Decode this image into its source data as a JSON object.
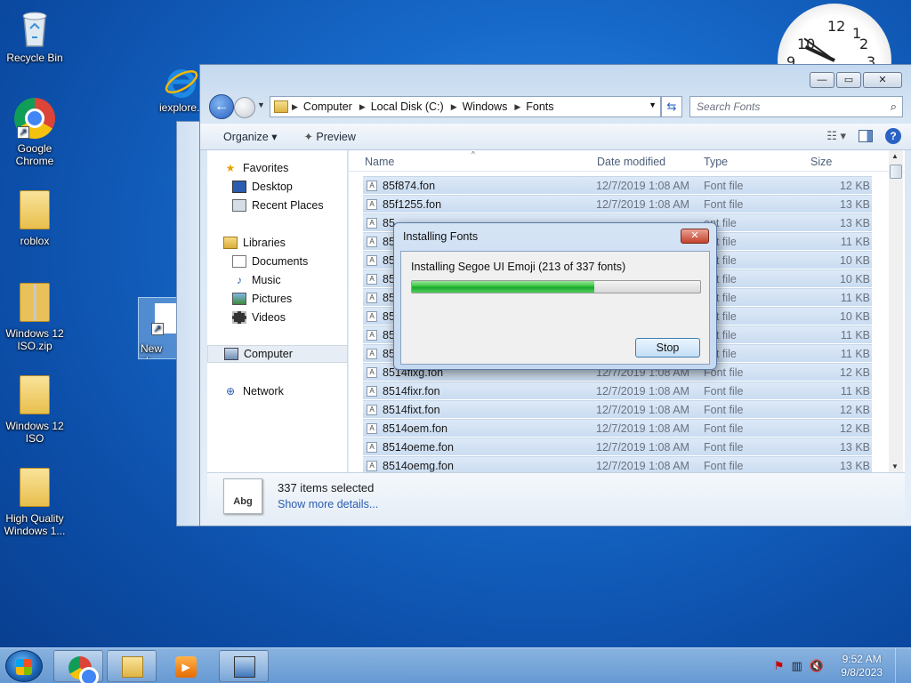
{
  "desktop": {
    "icons": [
      {
        "label": "Recycle Bin",
        "icon": "recycle-bin-icon"
      },
      {
        "label": "Google\nChrome",
        "icon": "chrome-icon"
      },
      {
        "label": "roblox",
        "icon": "folder-icon"
      },
      {
        "label": "Windows 12\nISO.zip",
        "icon": "zip-folder-icon"
      },
      {
        "label": "Windows 12\nISO",
        "icon": "folder-icon"
      },
      {
        "label": "High Quality\nWindows 1...",
        "icon": "folder-icon"
      },
      {
        "label": "iexplore...",
        "icon": "internet-explorer-icon"
      },
      {
        "label": "New sh...",
        "icon": "shortcut-icon"
      }
    ]
  },
  "clock": {
    "numbers": [
      "12",
      "1",
      "2",
      "3",
      "10",
      "9"
    ]
  },
  "explorer": {
    "controls": {
      "minimize": "—",
      "maximize": "▭",
      "close": "✕"
    },
    "breadcrumbs": [
      "Computer",
      "Local Disk (C:)",
      "Windows",
      "Fonts"
    ],
    "search_placeholder": "Search Fonts",
    "toolbar": {
      "organize": "Organize ▾",
      "preview": "Preview"
    },
    "nav": {
      "favorites": "Favorites",
      "desktop": "Desktop",
      "recent": "Recent Places",
      "libraries": "Libraries",
      "documents": "Documents",
      "music": "Music",
      "pictures": "Pictures",
      "videos": "Videos",
      "computer": "Computer",
      "network": "Network"
    },
    "columns": {
      "name": "Name",
      "date": "Date modified",
      "type": "Type",
      "size": "Size"
    },
    "files": [
      {
        "name": "85f874.fon",
        "date": "12/7/2019 1:08 AM",
        "type": "Font file",
        "size": "12 KB"
      },
      {
        "name": "85f1255.fon",
        "date": "12/7/2019 1:08 AM",
        "type": "Font file",
        "size": "13 KB"
      },
      {
        "name": "85",
        "date": "",
        "type": "ont file",
        "size": "13 KB"
      },
      {
        "name": "85",
        "date": "",
        "type": "ont file",
        "size": "11 KB"
      },
      {
        "name": "85",
        "date": "",
        "type": "ont file",
        "size": "10 KB"
      },
      {
        "name": "85",
        "date": "",
        "type": "ont file",
        "size": "10 KB"
      },
      {
        "name": "85",
        "date": "",
        "type": "ont file",
        "size": "11 KB"
      },
      {
        "name": "85",
        "date": "",
        "type": "ont file",
        "size": "10 KB"
      },
      {
        "name": "85",
        "date": "",
        "type": "ont file",
        "size": "11 KB"
      },
      {
        "name": "85",
        "date": "",
        "type": "ont file",
        "size": "11 KB"
      },
      {
        "name": "8514fixg.fon",
        "date": "12/7/2019 1:08 AM",
        "type": "Font file",
        "size": "12 KB"
      },
      {
        "name": "8514fixr.fon",
        "date": "12/7/2019 1:08 AM",
        "type": "Font file",
        "size": "11 KB"
      },
      {
        "name": "8514fixt.fon",
        "date": "12/7/2019 1:08 AM",
        "type": "Font file",
        "size": "12 KB"
      },
      {
        "name": "8514oem.fon",
        "date": "12/7/2019 1:08 AM",
        "type": "Font file",
        "size": "12 KB"
      },
      {
        "name": "8514oeme.fon",
        "date": "12/7/2019 1:08 AM",
        "type": "Font file",
        "size": "13 KB"
      },
      {
        "name": "8514oemg.fon",
        "date": "12/7/2019 1:08 AM",
        "type": "Font file",
        "size": "13 KB"
      }
    ],
    "details": {
      "count": "337 items selected",
      "link": "Show more details...",
      "icon_text": "Abg"
    }
  },
  "dialog": {
    "title": "Installing Fonts",
    "message": "Installing Segoe UI Emoji (213 of 337 fonts)",
    "progress_fraction": 0.632,
    "stop": "Stop",
    "close": "✕"
  },
  "taskbar": {
    "time": "9:52 AM",
    "date": "9/8/2023",
    "tray_icons": [
      "action-center-alert-icon",
      "network-icon",
      "volume-muted-icon"
    ]
  }
}
